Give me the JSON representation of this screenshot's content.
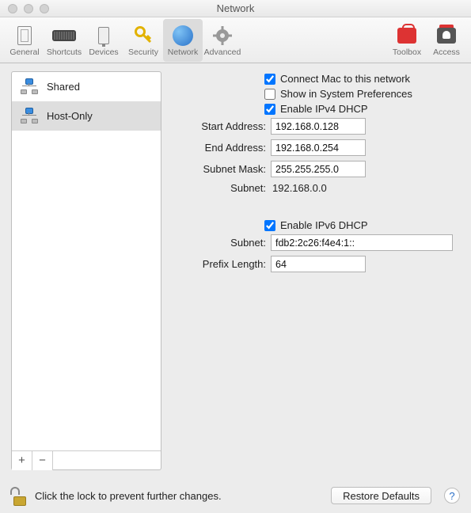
{
  "window": {
    "title": "Network"
  },
  "toolbar": {
    "items": [
      {
        "id": "general",
        "label": "General"
      },
      {
        "id": "shortcuts",
        "label": "Shortcuts"
      },
      {
        "id": "devices",
        "label": "Devices"
      },
      {
        "id": "security",
        "label": "Security"
      },
      {
        "id": "network",
        "label": "Network"
      },
      {
        "id": "advanced",
        "label": "Advanced"
      }
    ],
    "right": [
      {
        "id": "toolbox",
        "label": "Toolbox"
      },
      {
        "id": "access",
        "label": "Access"
      }
    ]
  },
  "sidebar": {
    "items": [
      {
        "label": "Shared",
        "selected": false
      },
      {
        "label": "Host-Only",
        "selected": true
      }
    ]
  },
  "form": {
    "connect_label": "Connect Mac to this network",
    "connect_checked": true,
    "syspref_label": "Show in System Preferences",
    "syspref_checked": false,
    "ipv4dhcp_label": "Enable IPv4 DHCP",
    "ipv4dhcp_checked": true,
    "start_label": "Start Address:",
    "start_value": "192.168.0.128",
    "end_label": "End Address:",
    "end_value": "192.168.0.254",
    "mask_label": "Subnet Mask:",
    "mask_value": "255.255.255.0",
    "subnet_label": "Subnet:",
    "subnet_value": "192.168.0.0",
    "ipv6dhcp_label": "Enable IPv6 DHCP",
    "ipv6dhcp_checked": true,
    "subnet6_label": "Subnet:",
    "subnet6_value": "fdb2:2c26:f4e4:1::",
    "prefix_label": "Prefix Length:",
    "prefix_value": "64"
  },
  "footer": {
    "lock_text": "Click the lock to prevent further changes.",
    "restore_label": "Restore Defaults"
  }
}
